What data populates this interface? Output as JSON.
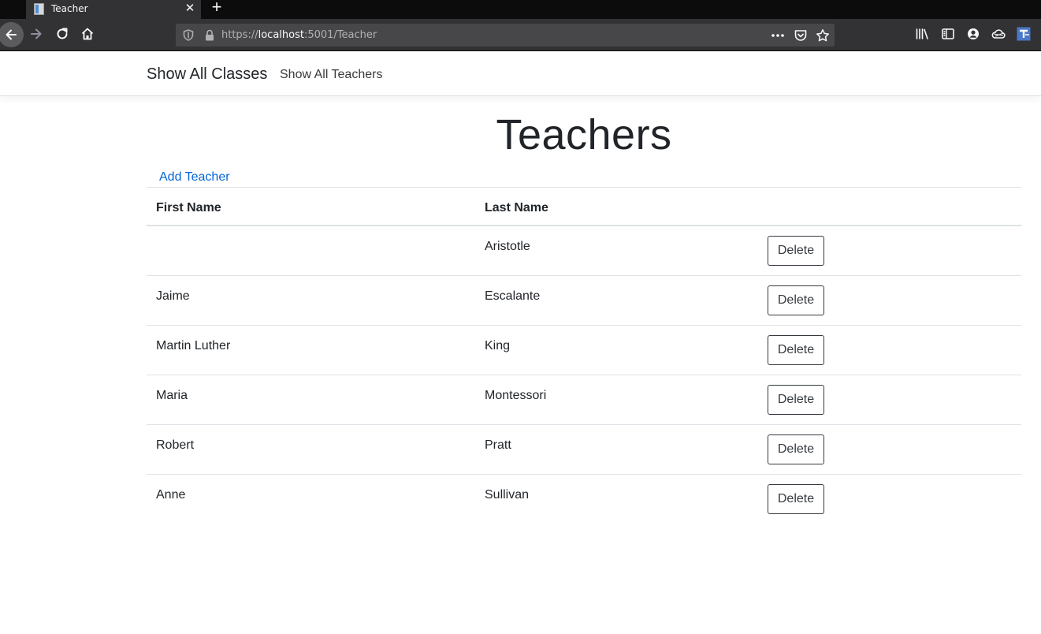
{
  "browser": {
    "tab_title": "Teacher",
    "url_scheme": "https://",
    "url_host": "localhost",
    "url_path": ":5001/Teacher",
    "colors": {
      "chrome_dark": "#0c0c0d",
      "toolbar": "#323234",
      "urlbar": "#474749"
    },
    "icons": [
      "page-icon",
      "close-icon",
      "plus-icon",
      "back-arrow-icon",
      "forward-arrow-icon",
      "reload-icon",
      "home-icon",
      "shield-icon",
      "lock-icon",
      "more-dots-icon",
      "pocket-icon",
      "star-icon",
      "library-icon",
      "sidebar-icon",
      "account-icon",
      "cloud-icon",
      "extension-icon"
    ]
  },
  "site_nav": {
    "brand": "Show All Classes",
    "link": "Show All Teachers"
  },
  "main": {
    "title": "Teachers",
    "add_link": "Add Teacher",
    "table": {
      "headers": [
        "First Name",
        "Last Name"
      ],
      "rows": [
        {
          "first": "",
          "last": "Aristotle",
          "action": "Delete"
        },
        {
          "first": "Jaime",
          "last": "Escalante",
          "action": "Delete"
        },
        {
          "first": "Martin Luther",
          "last": "King",
          "action": "Delete"
        },
        {
          "first": "Maria",
          "last": "Montessori",
          "action": "Delete"
        },
        {
          "first": "Robert",
          "last": "Pratt",
          "action": "Delete"
        },
        {
          "first": "Anne",
          "last": "Sullivan",
          "action": "Delete"
        }
      ]
    },
    "colors": {
      "link": "#0366d6",
      "text": "#212529",
      "border": "#dee2e6"
    }
  }
}
